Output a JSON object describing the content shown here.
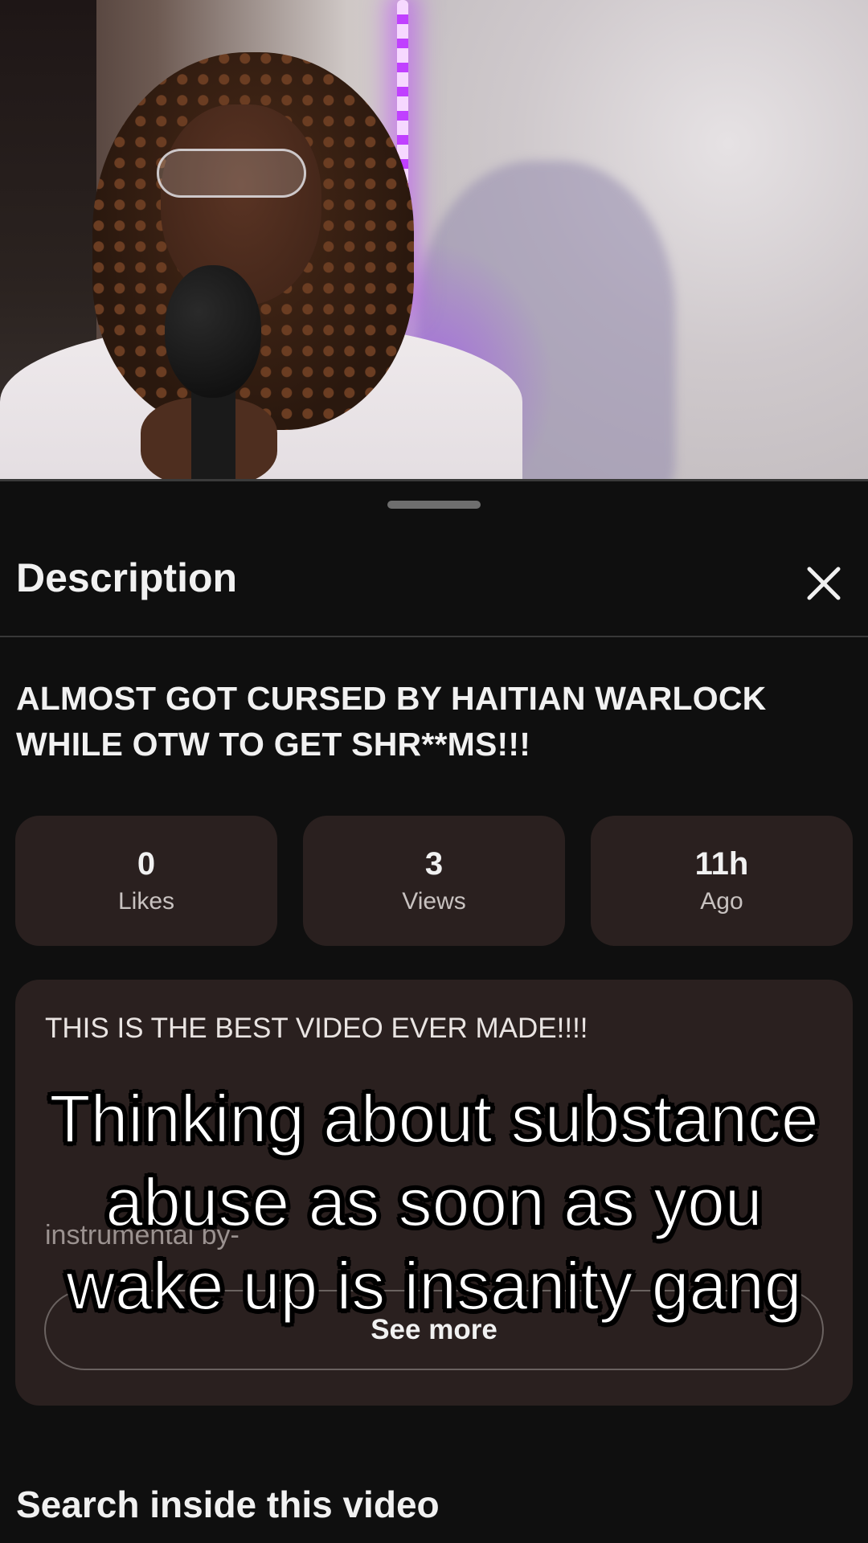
{
  "sheet": {
    "title": "Description",
    "close_icon": "close-icon"
  },
  "video": {
    "title": "ALMOST GOT CURSED BY HAITIAN WARLOCK WHILE OTW TO GET SHR**MS!!!",
    "stats": [
      {
        "value": "0",
        "label": "Likes"
      },
      {
        "value": "3",
        "label": "Views"
      },
      {
        "value": "11h",
        "label": "Ago"
      }
    ],
    "description": "THIS IS THE BEST VIDEO EVER MADE!!!!",
    "credit_fragment": "instrumental by-",
    "see_more_label": "See more"
  },
  "search_section": {
    "label": "Search inside this video"
  },
  "overlay": {
    "lines": [
      "Thinking about substance",
      "abuse as soon as you",
      "wake up is insanity gang"
    ]
  },
  "colors": {
    "background": "#0f0f0f",
    "card": "#2a201f",
    "text": "#f1f1f1",
    "led_accent": "#c040ff"
  }
}
